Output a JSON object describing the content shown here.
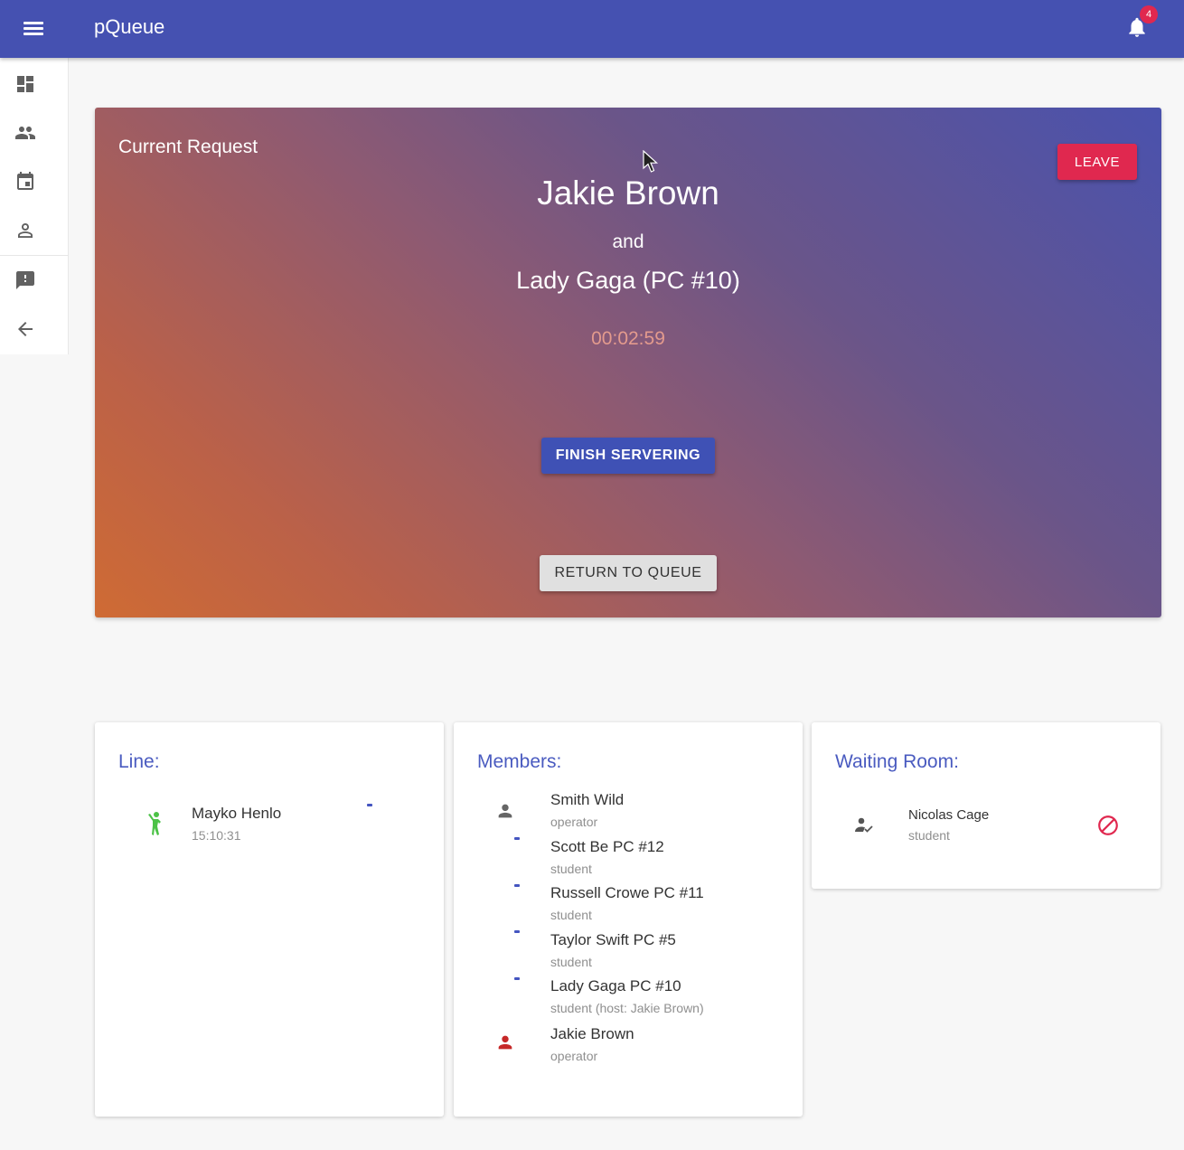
{
  "appbar": {
    "title": "pQueue",
    "notification_count": "4",
    "menu_icon": "menu-icon",
    "bell_icon": "bell-icon"
  },
  "sidebar": {
    "items": [
      {
        "icon": "dashboard-icon"
      },
      {
        "icon": "people-icon"
      },
      {
        "icon": "calendar-icon"
      },
      {
        "icon": "person-icon"
      },
      {
        "icon": "feedback-icon"
      },
      {
        "icon": "arrow-back-icon"
      }
    ]
  },
  "current_request": {
    "label": "Current Request",
    "host": "Jakie Brown",
    "connector": "and",
    "guest": "Lady Gaga (PC #10)",
    "timer": "00:02:59",
    "leave_label": "LEAVE",
    "finish_label": "FINISH SERVERING",
    "return_label": "RETURN TO QUEUE"
  },
  "line": {
    "title": "Line:",
    "items": [
      {
        "name": "Mayko Henlo",
        "time": "15:10:31",
        "icon": "person-waving-icon"
      }
    ]
  },
  "members": {
    "title": "Members:",
    "items": [
      {
        "name": "Smith Wild",
        "role": "operator",
        "icon": "person-icon"
      },
      {
        "name": "Scott Be PC #12",
        "role": "student"
      },
      {
        "name": "Russell Crowe PC #11",
        "role": "student"
      },
      {
        "name": "Taylor Swift PC #5",
        "role": "student"
      },
      {
        "name": "Lady Gaga PC #10",
        "role": "student (host: Jakie Brown)"
      },
      {
        "name": "Jakie Brown",
        "role": "operator",
        "icon": "person-icon"
      }
    ]
  },
  "waiting_room": {
    "title": "Waiting Room:",
    "items": [
      {
        "name": "Nicolas Cage",
        "role": "student",
        "icon": "person-check-icon",
        "action_icon": "block-icon"
      }
    ]
  },
  "colors": {
    "appbar": "#4551b1",
    "accent": "#e0284f",
    "primary": "#3f51b5",
    "title_blue": "#4a5bc0",
    "gradient_start": "#cf6b34",
    "gradient_end": "#4a52ad"
  }
}
